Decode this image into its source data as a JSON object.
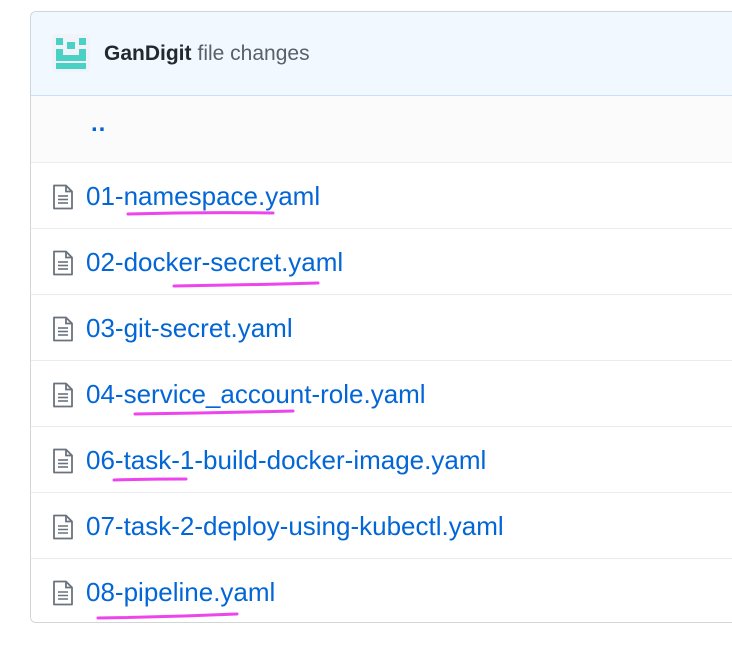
{
  "header": {
    "owner": "GanDigit",
    "title_rest": "file changes",
    "avatar_icon": "identicon-avatar",
    "avatar_color": "#48d1c4"
  },
  "parent_dir": {
    "label": ".."
  },
  "files": [
    {
      "name": "01-namespace.yaml",
      "icon": "file-text-icon"
    },
    {
      "name": "02-docker-secret.yaml",
      "icon": "file-text-icon"
    },
    {
      "name": "03-git-secret.yaml",
      "icon": "file-text-icon"
    },
    {
      "name": "04-service_account-role.yaml",
      "icon": "file-text-icon"
    },
    {
      "name": "06-task-1-build-docker-image.yaml",
      "icon": "file-text-icon"
    },
    {
      "name": "07-task-2-deploy-using-kubectl.yaml",
      "icon": "file-text-icon"
    },
    {
      "name": "08-pipeline.yaml",
      "icon": "file-text-icon"
    }
  ],
  "colors": {
    "link": "#0366d6",
    "header_bg": "#f1f8ff",
    "annotation": "#ee44ee"
  }
}
